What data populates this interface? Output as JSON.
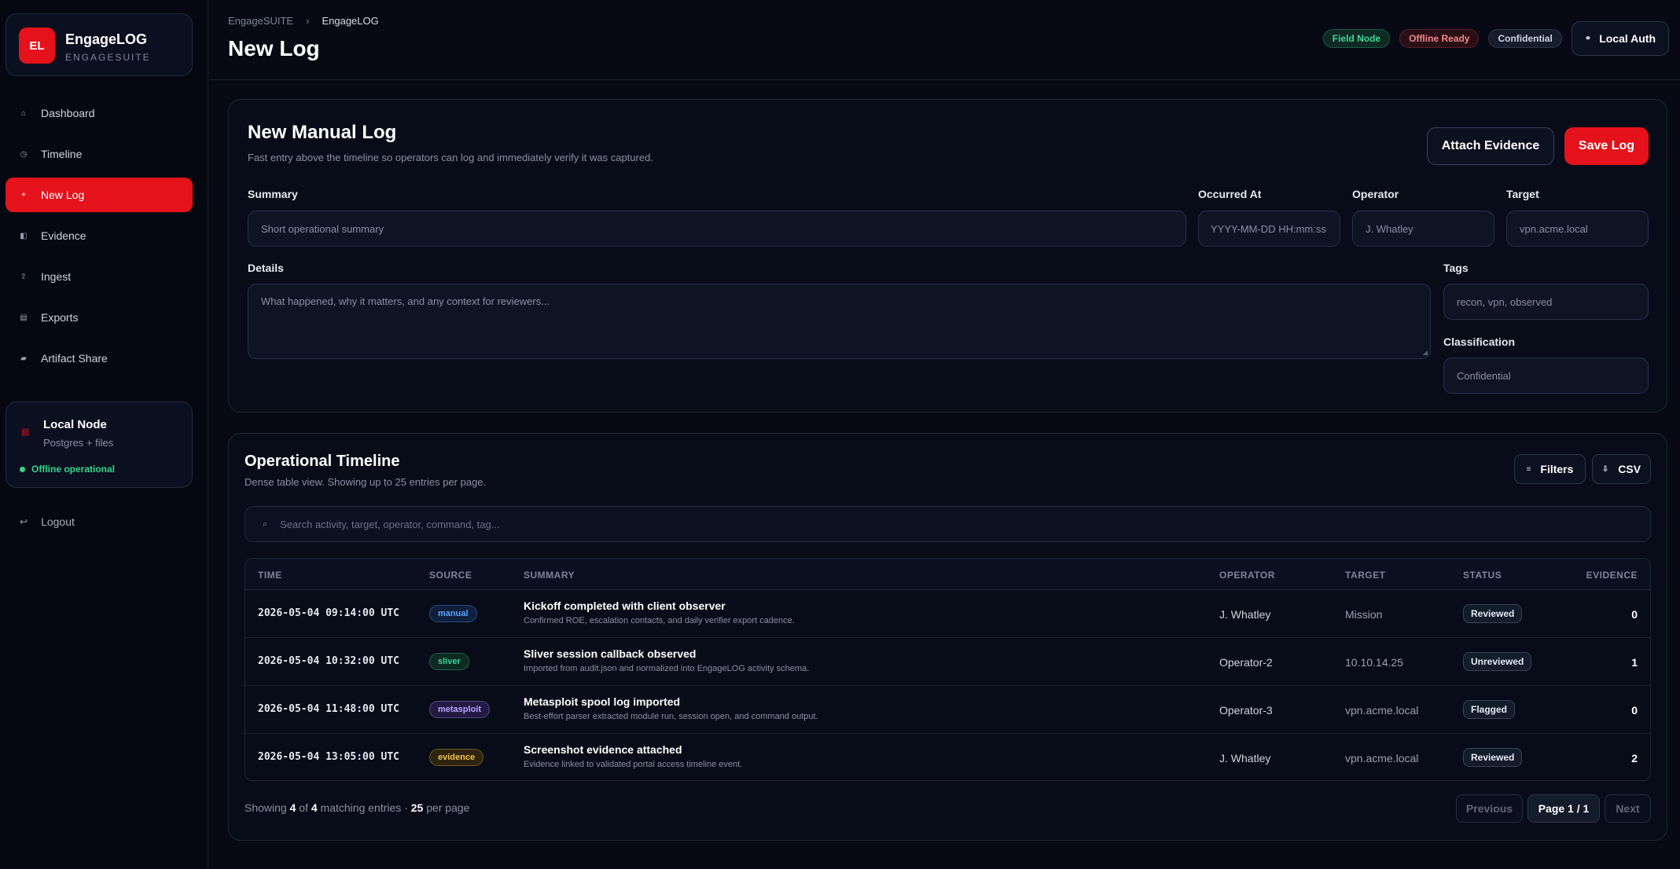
{
  "brand": {
    "logo": "EL",
    "title": "EngageLOG",
    "subtitle": "ENGAGESUITE"
  },
  "sidebar": {
    "items": [
      {
        "label": "Dashboard",
        "icon": "⌂",
        "icon_name": "home-icon",
        "active": false
      },
      {
        "label": "Timeline",
        "icon": "◷",
        "icon_name": "clock-icon",
        "active": false
      },
      {
        "label": "New Log",
        "icon": "+",
        "icon_name": "plus-icon",
        "active": true
      },
      {
        "label": "Evidence",
        "icon": "◧",
        "icon_name": "evidence-icon",
        "active": false
      },
      {
        "label": "Ingest",
        "icon": "⇧",
        "icon_name": "upload-icon",
        "active": false
      },
      {
        "label": "Exports",
        "icon": "▤",
        "icon_name": "export-icon",
        "active": false
      },
      {
        "label": "Artifact Share",
        "icon": "▰",
        "icon_name": "share-icon",
        "active": false
      }
    ],
    "node": {
      "title": "Local Node",
      "subtitle": "Postgres + files",
      "status": "Offline operational"
    },
    "logout": "Logout"
  },
  "header": {
    "breadcrumb": [
      "EngageSUITE",
      "EngageLOG"
    ],
    "separator": "›",
    "title": "New Log",
    "badges": [
      "Field Node",
      "Offline Ready",
      "Confidential"
    ],
    "auth_label": "Local Auth"
  },
  "form": {
    "title": "New Manual Log",
    "subtitle": "Fast entry above the timeline so operators can log and immediately verify it was captured.",
    "attach_label": "Attach Evidence",
    "save_label": "Save Log",
    "summary_label": "Summary",
    "summary_placeholder": "Short operational summary",
    "occurred_label": "Occurred At",
    "occurred_placeholder": "YYYY-MM-DD HH:mm:ss",
    "operator_label": "Operator",
    "operator_value": "J. Whatley",
    "target_label": "Target",
    "target_value": "vpn.acme.local",
    "details_label": "Details",
    "details_placeholder": "What happened, why it matters, and any context for reviewers...",
    "tags_label": "Tags",
    "tags_value": "recon, vpn, observed",
    "classification_label": "Classification",
    "classification_value": "Confidential"
  },
  "timeline": {
    "title": "Operational Timeline",
    "subtitle": "Dense table view. Showing up to 25 entries per page.",
    "filters_label": "Filters",
    "csv_label": "CSV",
    "search_placeholder": "Search activity, target, operator, command, tag...",
    "columns": {
      "time": "TIME",
      "source": "SOURCE",
      "summary": "SUMMARY",
      "operator": "OPERATOR",
      "target": "TARGET",
      "status": "STATUS",
      "evidence": "EVIDENCE"
    },
    "rows": [
      {
        "time": "2026-05-04 09:14:00 UTC",
        "source": "manual",
        "source_color": "#5aa7ff",
        "source_bg": "#0f1f3d",
        "title": "Kickoff completed with client observer",
        "detail": "Confirmed ROE, escalation contacts, and daily verifier export cadence.",
        "operator": "J. Whatley",
        "target": "Mission",
        "status": "Reviewed",
        "evidence": "0"
      },
      {
        "time": "2026-05-04 10:32:00 UTC",
        "source": "sliver",
        "source_color": "#3fd69a",
        "source_bg": "#0e2a22",
        "title": "Sliver session callback observed",
        "detail": "Imported from audit.json and normalized into EngageLOG activity schema.",
        "operator": "Operator-2",
        "target": "10.10.14.25",
        "status": "Unreviewed",
        "evidence": "1"
      },
      {
        "time": "2026-05-04 11:48:00 UTC",
        "source": "metasploit",
        "source_color": "#b9a4ff",
        "source_bg": "#221a42",
        "title": "Metasploit spool log imported",
        "detail": "Best-effort parser extracted module run, session open, and command output.",
        "operator": "Operator-3",
        "target": "vpn.acme.local",
        "status": "Flagged",
        "evidence": "0"
      },
      {
        "time": "2026-05-04 13:05:00 UTC",
        "source": "evidence",
        "source_color": "#f2c14a",
        "source_bg": "#2e2410",
        "title": "Screenshot evidence attached",
        "detail": "Evidence linked to validated portal access timeline event.",
        "operator": "J. Whatley",
        "target": "vpn.acme.local",
        "status": "Reviewed",
        "evidence": "2"
      }
    ],
    "footer": {
      "prefix": "Showing",
      "shown": "4",
      "of": "of",
      "total": "4",
      "matching": "matching entries ·",
      "per_page": "25",
      "per_page_suffix": "per page"
    },
    "pagination": {
      "previous": "Previous",
      "page": "Page 1 / 1",
      "next": "Next"
    }
  },
  "colors": {
    "accent": "#e5121b",
    "background": "#070a14",
    "success": "#35d38a"
  }
}
